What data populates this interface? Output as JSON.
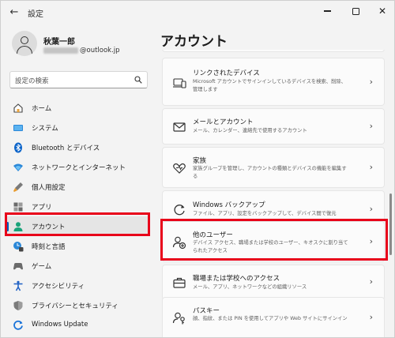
{
  "window": {
    "title": "設定",
    "back_glyph": "←"
  },
  "user": {
    "name": "秋葉一郎",
    "email_visible": "@outlook.jp"
  },
  "search": {
    "placeholder": "設定の検索"
  },
  "page": {
    "title": "アカウント"
  },
  "nav": {
    "items": [
      {
        "label": "ホーム",
        "icon": "home-icon"
      },
      {
        "label": "システム",
        "icon": "system-icon"
      },
      {
        "label": "Bluetooth とデバイス",
        "icon": "bluetooth-icon"
      },
      {
        "label": "ネットワークとインターネット",
        "icon": "network-icon"
      },
      {
        "label": "個人用設定",
        "icon": "brush-icon"
      },
      {
        "label": "アプリ",
        "icon": "apps-icon"
      },
      {
        "label": "アカウント",
        "icon": "account-icon",
        "selected": true
      },
      {
        "label": "時刻と言語",
        "icon": "time-language-icon"
      },
      {
        "label": "ゲーム",
        "icon": "gaming-icon"
      },
      {
        "label": "アクセシビリティ",
        "icon": "accessibility-icon"
      },
      {
        "label": "プライバシーとセキュリティ",
        "icon": "shield-icon"
      },
      {
        "label": "Windows Update",
        "icon": "update-icon"
      }
    ]
  },
  "cards": [
    {
      "title": "リンクされたデバイス",
      "desc": "Microsoft アカウントでサインインしているデバイスを検索、削除、管理します",
      "icon": "laptop-phone-icon"
    },
    {
      "title": "メールとアカウント",
      "desc": "メール、カレンダー、連絡先で使用するアカウント",
      "icon": "mail-icon"
    },
    {
      "title": "家族",
      "desc": "家族グループを管理し、アカウントの種類とデバイスの機能を編集する",
      "icon": "family-heart-icon"
    },
    {
      "title": "Windows バックアップ",
      "desc": "ファイル、アプリ、設定をバックアップして、デバイス間で復元",
      "icon": "backup-icon"
    },
    {
      "title": "他のユーザー",
      "desc": "デバイス アクセス、職場または学校のユーザー、キオスクに割り当てられたアクセス",
      "icon": "other-users-icon"
    },
    {
      "title": "職場または学校へのアクセス",
      "desc": "メール、アプリ、ネットワークなどの組織リソース",
      "icon": "briefcase-icon"
    },
    {
      "title": "パスキー",
      "desc": "顔、指紋、または PIN を使用してアプリや Web サイトにサインイン",
      "icon": "passkey-icon"
    }
  ],
  "colors": {
    "accent": "#005fb8",
    "highlight_box": "#e8001a",
    "window_bg": "#f3f3f3",
    "card_bg": "#fbfbfb"
  }
}
